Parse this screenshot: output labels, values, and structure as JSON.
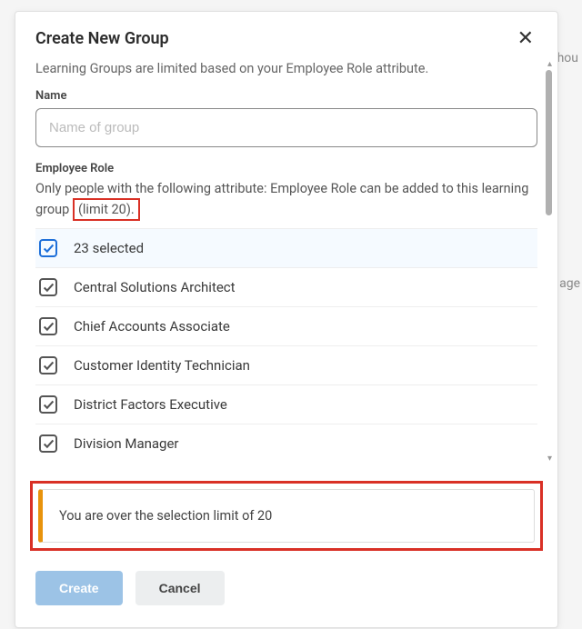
{
  "bg": {
    "hint1": "hou",
    "hint2": "age"
  },
  "modal": {
    "title": "Create New Group",
    "close_symbol": "✕",
    "subtitle": "Learning Groups are limited based on your Employee Role attribute.",
    "name_field": {
      "label": "Name",
      "placeholder": "Name of group",
      "value": ""
    },
    "role_section": {
      "label": "Employee Role",
      "help_pre": "Only people with the following attribute: Employee Role can be added to this learning group",
      "help_limit": "(limit 20).",
      "selected_summary": "23 selected",
      "items": [
        "Central Solutions Architect",
        "Chief Accounts Associate",
        "Customer Identity Technician",
        "District Factors Executive",
        "Division Manager"
      ]
    },
    "warning": "You are over the selection limit of 20",
    "buttons": {
      "create": "Create",
      "cancel": "Cancel"
    }
  }
}
